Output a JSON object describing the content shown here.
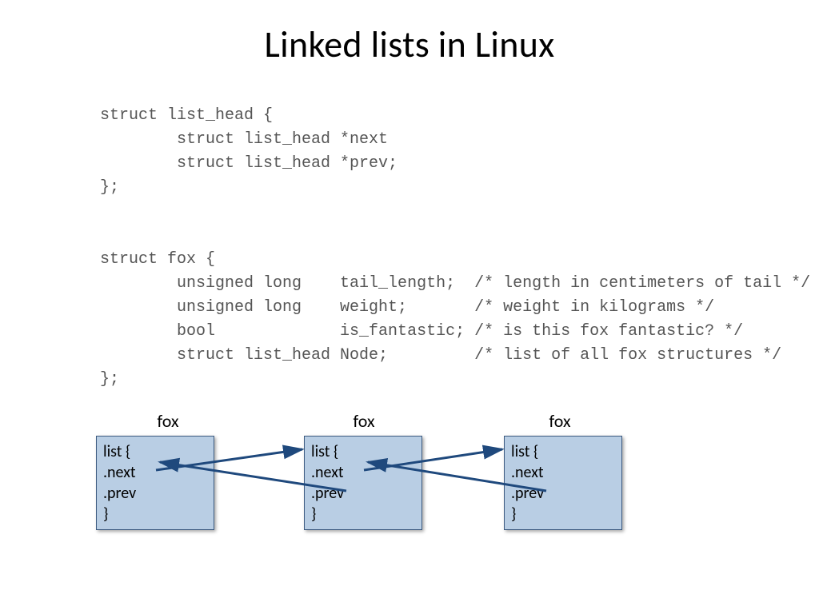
{
  "title": "Linked lists in Linux",
  "code": "struct list_head {\n        struct list_head *next\n        struct list_head *prev;\n};\n\n\nstruct fox {\n        unsigned long    tail_length;  /* length in centimeters of tail */\n        unsigned long    weight;       /* weight in kilograms */\n        bool             is_fantastic; /* is this fox fantastic? */\n        struct list_head Node;         /* list of all foх structures */\n};",
  "boxes": {
    "label": "fox",
    "line1": "list {",
    "line2": "   .next",
    "line3": "   .prev",
    "line4": "}"
  },
  "colors": {
    "arrow": "#1f497d"
  }
}
